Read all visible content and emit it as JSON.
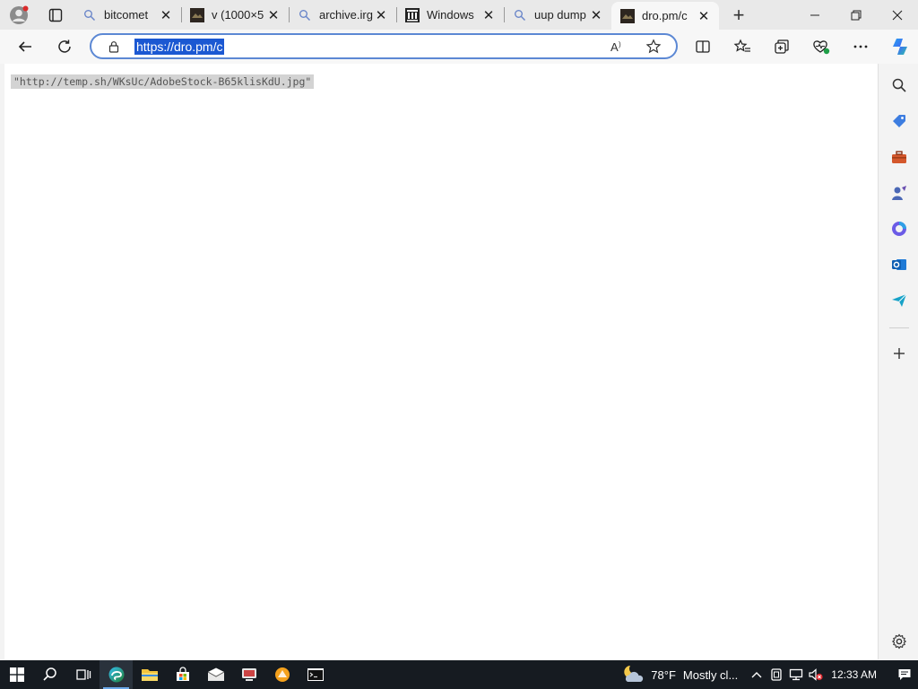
{
  "browser": {
    "tabs": [
      {
        "title": "bitcomet",
        "icon": "search-icon",
        "active": false
      },
      {
        "title": "v (1000×5",
        "icon": "image-thumbnail-icon",
        "active": false
      },
      {
        "title": "archive.irg",
        "icon": "search-icon",
        "active": false
      },
      {
        "title": "Windows",
        "icon": "archive-building-icon",
        "active": false
      },
      {
        "title": "uup dump",
        "icon": "search-icon",
        "active": false
      },
      {
        "title": "dro.pm/c",
        "icon": "image-thumbnail-icon",
        "active": true
      }
    ],
    "new_tab_label": "+",
    "address_bar": {
      "url": "https://dro.pm/c"
    }
  },
  "page": {
    "text": "\"http://temp.sh/WKsUc/AdobeStock-B65klisKdU.jpg\""
  },
  "taskbar": {
    "weather_temp": "78°F",
    "weather_desc": "Mostly cl...",
    "clock": "12:33 AM"
  },
  "colors": {
    "accent": "#1b58d2",
    "taskbar_bg": "#161b21"
  }
}
